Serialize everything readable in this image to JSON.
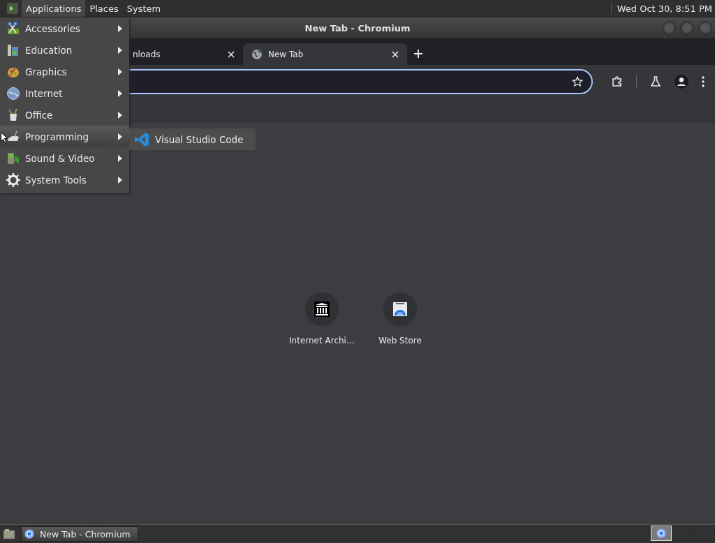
{
  "top_panel": {
    "menus": [
      {
        "label": "Applications",
        "selected": true
      },
      {
        "label": "Places",
        "selected": false
      },
      {
        "label": "System",
        "selected": false
      }
    ],
    "clock": "Wed Oct 30,  8:51 PM"
  },
  "window": {
    "title": "New Tab - Chromium"
  },
  "tabs": [
    {
      "label": "nloads",
      "selected": false
    },
    {
      "label": "New Tab",
      "selected": true
    }
  ],
  "shortcuts": [
    {
      "label": "Internet Archi…"
    },
    {
      "label": "Web Store"
    }
  ],
  "applications_menu": {
    "items": [
      {
        "label": "Accessories",
        "selected": false
      },
      {
        "label": "Education",
        "selected": false
      },
      {
        "label": "Graphics",
        "selected": false
      },
      {
        "label": "Internet",
        "selected": false
      },
      {
        "label": "Office",
        "selected": false
      },
      {
        "label": "Programming",
        "selected": true
      },
      {
        "label": "Sound & Video",
        "selected": false
      },
      {
        "label": "System Tools",
        "selected": false
      }
    ],
    "submenu": {
      "items": [
        {
          "label": "Visual Studio Code"
        }
      ]
    }
  },
  "taskbar": {
    "tasks": [
      {
        "label": "New Tab - Chromium",
        "selected": true
      }
    ]
  }
}
